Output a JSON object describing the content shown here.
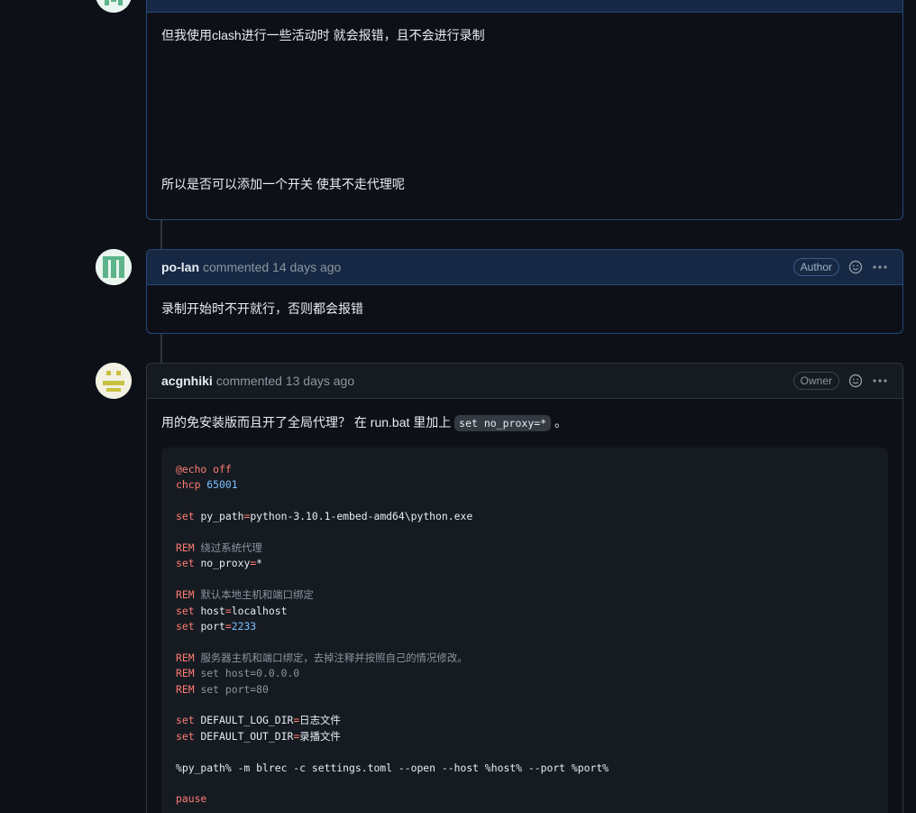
{
  "comments": [
    {
      "paragraph1": "但我使用clash进行一些活动时 就会报错，且不会进行录制",
      "paragraph2": "所以是否可以添加一个开关 使其不走代理呢"
    },
    {
      "author": "po-lan",
      "meta": "commented 14 days ago",
      "badge": "Author",
      "body": "录制开始时不开就行，否则都会报错"
    },
    {
      "author": "acgnhiki",
      "meta": "commented 13 days ago",
      "badge": "Owner",
      "body_prefix": "用的免安装版而且开了全局代理？ 在 run.bat 里加上",
      "inline_code": "set no_proxy=*",
      "body_suffix": "。"
    }
  ],
  "code_block": {
    "language": "batch",
    "lines": [
      {
        "kw": "@echo off",
        "rest": ""
      },
      {
        "kw": "chcp ",
        "num": "65001"
      },
      {
        "blank": true
      },
      {
        "kw": "set ",
        "rest": "py_path=python-3.10.1-embed-amd64\\python.exe"
      },
      {
        "blank": true
      },
      {
        "kw": "REM ",
        "cm": "绕过系统代理"
      },
      {
        "kw": "set ",
        "rest": "no_proxy=*"
      },
      {
        "blank": true
      },
      {
        "kw": "REM ",
        "cm": "默认本地主机和端口绑定"
      },
      {
        "kw": "set ",
        "rest": "host=localhost"
      },
      {
        "kw": "set ",
        "rest": "port=",
        "num": "2233"
      },
      {
        "blank": true
      },
      {
        "kw": "REM ",
        "cm": "服务器主机和端口绑定，去掉注释并按照自己的情况修改。"
      },
      {
        "kw": "REM ",
        "cm": "set host=0.0.0.0"
      },
      {
        "kw": "REM ",
        "cm": "set port=80"
      },
      {
        "blank": true
      },
      {
        "kw": "set ",
        "rest": "DEFAULT_LOG_DIR=日志文件"
      },
      {
        "kw": "set ",
        "rest": "DEFAULT_OUT_DIR=录播文件"
      },
      {
        "blank": true
      },
      {
        "kw": "",
        "rest": "%py_path% -m blrec -c settings.toml --open --host %host% --port %port%"
      },
      {
        "blank": true
      },
      {
        "kw": "pause",
        "rest": ""
      }
    ]
  },
  "colors": {
    "background": "#0d1117",
    "keyword": "#ff7b72",
    "number": "#79c0ff",
    "author_header": "#162843"
  },
  "icons": [
    "smiley-icon",
    "kebab-horizontal-icon"
  ]
}
